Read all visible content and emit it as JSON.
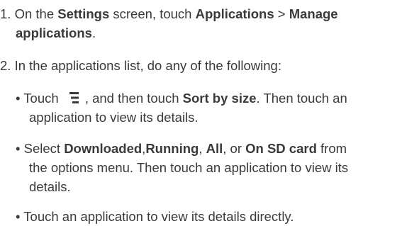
{
  "steps": [
    {
      "number": "1.",
      "text1": "On the",
      "settings": "Settings",
      "text2": "screen, touch",
      "applications": "Applications",
      "separator": ">",
      "manage_line1": "Manage",
      "manage_line2": "applications",
      "period": "."
    },
    {
      "number": "2.",
      "text": "In the applications list, do any of the following:"
    }
  ],
  "bullets": [
    {
      "symbol": "•",
      "touch": "Touch",
      "icon": "menu-icon",
      "after_icon": ", and then touch",
      "sort": "Sort by size",
      "rest_line1": ". Then touch an",
      "line2": "application to view its details."
    },
    {
      "symbol": "•",
      "select": "Select",
      "downloaded": "Downloaded",
      "comma1": ",",
      "running": "Running",
      "comma2": ",",
      "all": "All",
      "or": ", or",
      "sdcard": "On SD card",
      "from": "from",
      "line2": "the options menu. Then touch an application to view its",
      "line3": "details."
    },
    {
      "symbol": "•",
      "text": "Touch an application to view its details directly."
    }
  ]
}
